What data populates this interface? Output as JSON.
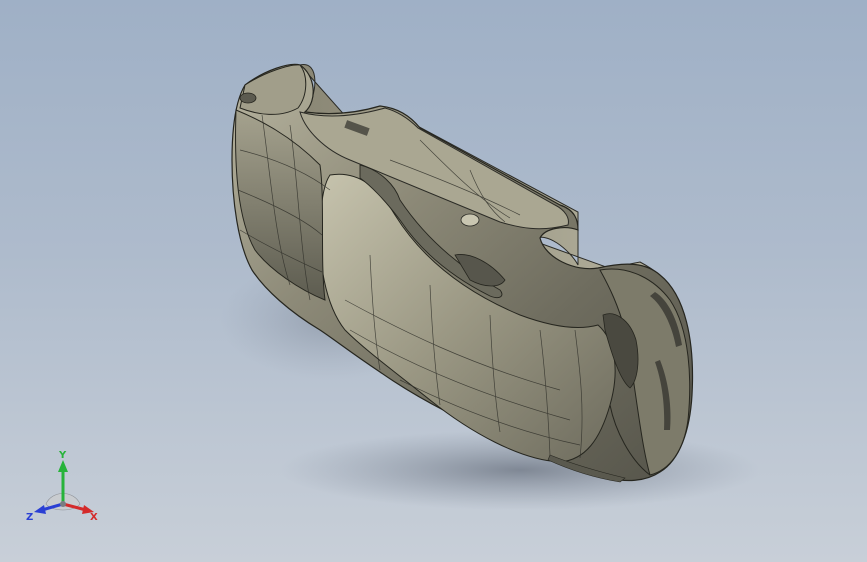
{
  "triad": {
    "x_label": "X",
    "y_label": "Y",
    "z_label": "Z",
    "x_color": "#d42a2a",
    "y_color": "#27b33a",
    "z_color": "#2a3fd4"
  },
  "model": {
    "name": "car-body-shell",
    "body_color": "#8f8c7b"
  },
  "viewport": {
    "background_top": "#9fb0c6",
    "background_bottom": "#c8cfd8"
  }
}
